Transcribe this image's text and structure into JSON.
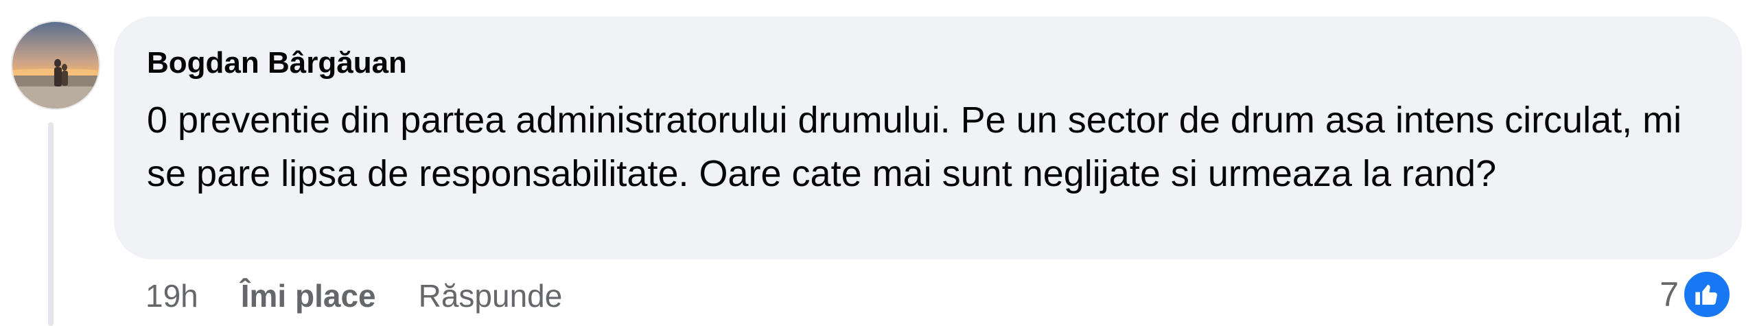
{
  "comment": {
    "author": "Bogdan Bârgăuan",
    "text": "0 preventie din partea administratorului drumului. Pe un sector de drum asa intens circulat, mi se pare lipsa de responsabilitate. Oare cate mai sunt neglijate si urmeaza la rand?",
    "avatar_icon": "profile-photo-sunset-beach"
  },
  "actions": {
    "timestamp": "19h",
    "like_label": "Îmi place",
    "reply_label": "Răspunde"
  },
  "reactions": {
    "count": "7",
    "icon": "like-thumbs-up-icon",
    "color": "#1877f2"
  },
  "colors": {
    "bubble_bg": "#f0f2f5",
    "text": "#050505",
    "secondary_text": "#65676b",
    "accent": "#1877f2"
  }
}
